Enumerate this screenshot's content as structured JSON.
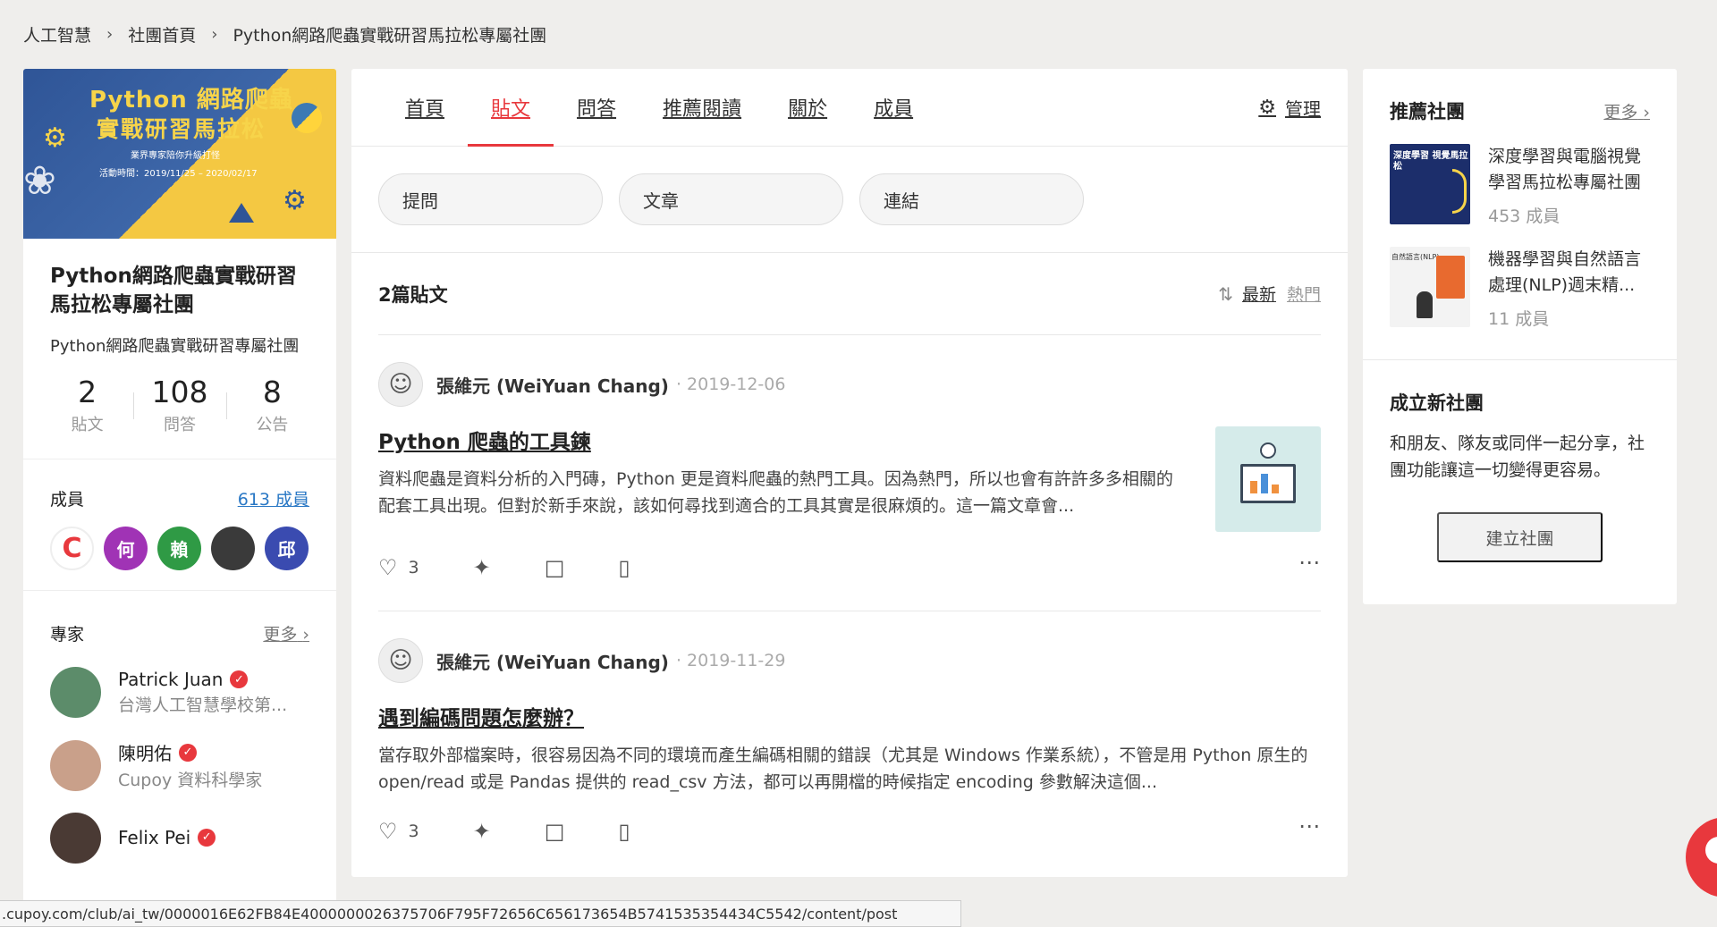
{
  "breadcrumb": [
    "人工智慧",
    "社團首頁",
    "Python網路爬蟲實戰研習馬拉松專屬社團"
  ],
  "banner": {
    "title_line1": "Python 網路爬蟲",
    "title_line2": "實戰研習馬拉松",
    "sub1": "業界專家陪你升級打怪",
    "sub2": "活動時間：2019/11/25 – 2020/02/17"
  },
  "club": {
    "name": "Python網路爬蟲實戰研習馬拉松專屬社團",
    "description": "Python網路爬蟲實戰研習專屬社團",
    "stats": [
      {
        "num": "2",
        "label": "貼文"
      },
      {
        "num": "108",
        "label": "問答"
      },
      {
        "num": "8",
        "label": "公告"
      }
    ]
  },
  "members": {
    "title": "成員",
    "count": "613 成員",
    "avatars": [
      "C",
      "何",
      "賴",
      "",
      "邱"
    ]
  },
  "experts": {
    "title": "專家",
    "more": "更多",
    "list": [
      {
        "name": "Patrick Juan",
        "title": "台灣人工智慧學校第..."
      },
      {
        "name": "陳明佑",
        "title": "Cupoy 資料科學家"
      },
      {
        "name": "Felix Pei",
        "title": ""
      }
    ]
  },
  "tabs": [
    "首頁",
    "貼文",
    "問答",
    "推薦閱讀",
    "關於",
    "成員"
  ],
  "active_tab": "貼文",
  "manage_label": "管理",
  "post_types": [
    "提問",
    "文章",
    "連結"
  ],
  "posts_header": {
    "count": "2篇貼文",
    "sort_latest": "最新",
    "sort_hot": "熱門"
  },
  "posts": [
    {
      "author": "張維元 (WeiYuan Chang)",
      "date": "· 2019-12-06",
      "title": "Python 爬蟲的工具鍊",
      "excerpt": "資料爬蟲是資料分析的入門磚，Python 更是資料爬蟲的熱門工具。因為熱門，所以也會有許許多多相關的配套工具出現。但對於新手來說，該如何尋找到適合的工具其實是很麻煩的。這一篇文章會...",
      "likes": "3"
    },
    {
      "author": "張維元 (WeiYuan Chang)",
      "date": "· 2019-11-29",
      "title": "遇到編碼問題怎麼辦？",
      "excerpt": "當存取外部檔案時，很容易因為不同的環境而產生編碼相關的錯誤（尤其是 Windows 作業系統），不管是用 Python 原生的 open/read 或是 Pandas 提供的 read_csv 方法，都可以再開檔的時候指定 encoding 參數解決這個...",
      "likes": "3"
    }
  ],
  "recommended": {
    "title": "推薦社團",
    "more": "更多",
    "clubs": [
      {
        "name": "深度學習與電腦視覺學習馬拉松專屬社團",
        "members": "453 成員",
        "thumb_text": "深度學習 視覺馬拉松"
      },
      {
        "name": "機器學習與自然語言處理(NLP)週末精...",
        "members": "11 成員",
        "thumb_text": "自然語言(NLP)"
      }
    ]
  },
  "new_club": {
    "title": "成立新社團",
    "description": "和朋友、隊友或同伴一起分享，社團功能讓這一切變得更容易。",
    "button": "建立社團"
  },
  "status_url": ".cupoy.com/club/ai_tw/0000016E62FB84E4000000026375706F795F72656C656173654B5741535354434C5542/content/post",
  "colors": {
    "accent": "#e8383d",
    "link": "#2a78c5",
    "background": "#efeeec"
  }
}
